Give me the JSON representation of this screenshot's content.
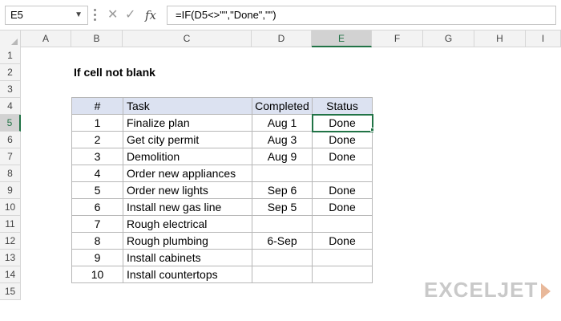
{
  "formula_bar": {
    "name_box": "E5",
    "name_box_chevron": "chevron-down-icon",
    "cancel_glyph": "✕",
    "enter_glyph": "✓",
    "fx_label": "fx",
    "formula": "=IF(D5<>\"\",\"Done\",\"\")"
  },
  "columns": [
    "A",
    "B",
    "C",
    "D",
    "E",
    "F",
    "G",
    "H",
    "I"
  ],
  "selected_column": "E",
  "rows": [
    "1",
    "2",
    "3",
    "4",
    "5",
    "6",
    "7",
    "8",
    "9",
    "10",
    "11",
    "12",
    "13",
    "14",
    "15"
  ],
  "selected_row": "5",
  "sheet": {
    "title": "If cell not blank",
    "headers": [
      "#",
      "Task",
      "Completed",
      "Status"
    ],
    "records": [
      {
        "num": "1",
        "task": "Finalize plan",
        "completed": "Aug 1",
        "status": "Done"
      },
      {
        "num": "2",
        "task": "Get city permit",
        "completed": "Aug 3",
        "status": "Done"
      },
      {
        "num": "3",
        "task": "Demolition",
        "completed": "Aug 9",
        "status": "Done"
      },
      {
        "num": "4",
        "task": "Order new appliances",
        "completed": "",
        "status": ""
      },
      {
        "num": "5",
        "task": "Order new lights",
        "completed": "Sep 6",
        "status": "Done"
      },
      {
        "num": "6",
        "task": "Install new gas line",
        "completed": "Sep 5",
        "status": "Done"
      },
      {
        "num": "7",
        "task": "Rough electrical",
        "completed": "",
        "status": ""
      },
      {
        "num": "8",
        "task": "Rough plumbing",
        "completed": "6-Sep",
        "status": "Done"
      },
      {
        "num": "9",
        "task": "Install cabinets",
        "completed": "",
        "status": ""
      },
      {
        "num": "10",
        "task": "Install countertops",
        "completed": "",
        "status": ""
      }
    ]
  },
  "colors": {
    "header_fill": "#dce2f1",
    "selection_accent": "#217346",
    "gridline": "#d6d6d6"
  },
  "logo": {
    "text": "EXCELJET",
    "mark": "exceljet-logo-icon"
  }
}
